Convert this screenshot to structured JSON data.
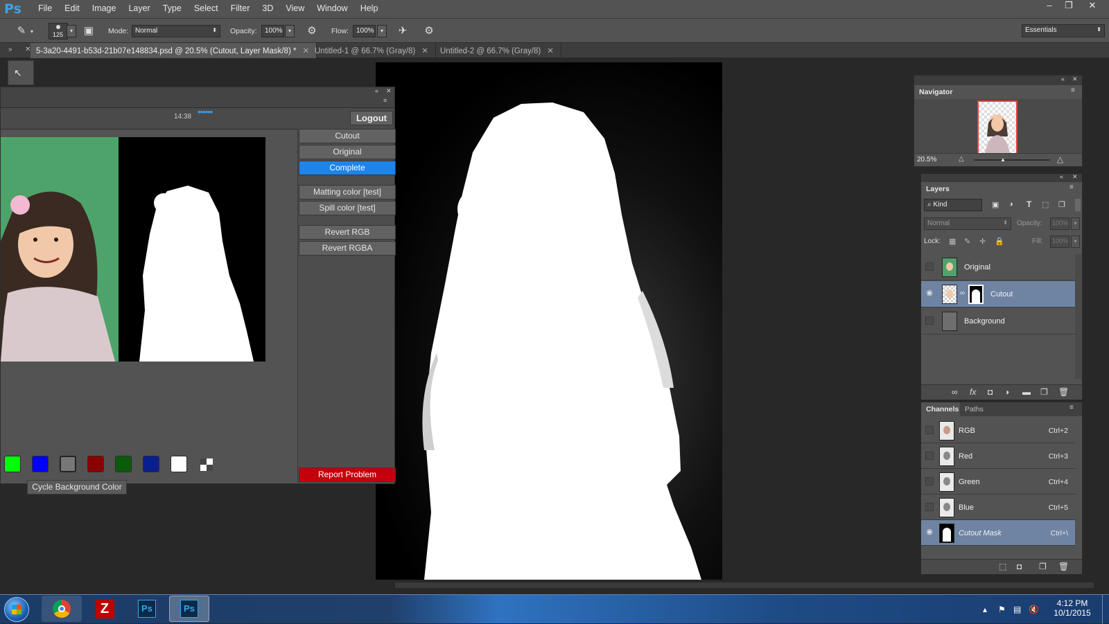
{
  "app": {
    "logo": "Ps"
  },
  "menu": [
    "File",
    "Edit",
    "Image",
    "Layer",
    "Type",
    "Select",
    "Filter",
    "3D",
    "View",
    "Window",
    "Help"
  ],
  "window_controls": {
    "minimize": "–",
    "restore": "❐",
    "close": "✕"
  },
  "options": {
    "brush_size": "125",
    "mode_label": "Mode:",
    "mode_value": "Normal",
    "opacity_label": "Opacity:",
    "opacity_value": "100%",
    "flow_label": "Flow:",
    "flow_value": "100%",
    "workspace": "Essentials"
  },
  "tabs": [
    {
      "label": "5-3a20-4491-b53d-21b07e148834.psd @ 20.5% (Cutout, Layer Mask/8) *",
      "active": true
    },
    {
      "label": "Untitled-1 @ 66.7% (Gray/8)",
      "active": false
    },
    {
      "label": "Untitled-2 @ 66.7% (Gray/8)",
      "active": false
    }
  ],
  "plugin": {
    "time": "14:38",
    "dots": "••••••",
    "logout": "Logout",
    "buttons": [
      "Cutout",
      "Original",
      "Complete",
      "Matting color [test]",
      "Spill color [test]",
      "Revert RGB",
      "Revert RGBA"
    ],
    "active_button": "Complete",
    "report": "Report Problem",
    "cycle_bg": "Cycle Background Color",
    "swatches": [
      "#00ff00",
      "#0000ff",
      "#777777",
      "#8b0000",
      "#0a5c0a",
      "#0a1f8f",
      "#ffffff",
      "checker"
    ]
  },
  "navigator": {
    "title": "Navigator",
    "zoom": "20.5%"
  },
  "layers": {
    "title": "Layers",
    "filter": "Kind",
    "blend": "Normal",
    "opacity_label": "Opacity:",
    "opacity_value": "100%",
    "lock_label": "Lock:",
    "fill_label": "Fill:",
    "fill_value": "100%",
    "items": [
      {
        "name": "Original",
        "visible": false,
        "selected": false
      },
      {
        "name": "Cutout",
        "visible": true,
        "selected": true
      },
      {
        "name": "Background",
        "visible": false,
        "selected": false
      }
    ]
  },
  "channels": {
    "tabs": [
      "Channels",
      "Paths"
    ],
    "items": [
      {
        "name": "RGB",
        "shortcut": "Ctrl+2",
        "visible": false,
        "selected": false
      },
      {
        "name": "Red",
        "shortcut": "Ctrl+3",
        "visible": false,
        "selected": false
      },
      {
        "name": "Green",
        "shortcut": "Ctrl+4",
        "visible": false,
        "selected": false
      },
      {
        "name": "Blue",
        "shortcut": "Ctrl+5",
        "visible": false,
        "selected": false
      },
      {
        "name": "Cutout Mask",
        "shortcut": "Ctrl+\\",
        "visible": true,
        "selected": true
      }
    ]
  },
  "taskbar": {
    "apps": [
      "start",
      "chrome",
      "filezilla",
      "photoshop",
      "photoshop-active"
    ],
    "time": "4:12 PM",
    "date": "10/1/2015"
  }
}
